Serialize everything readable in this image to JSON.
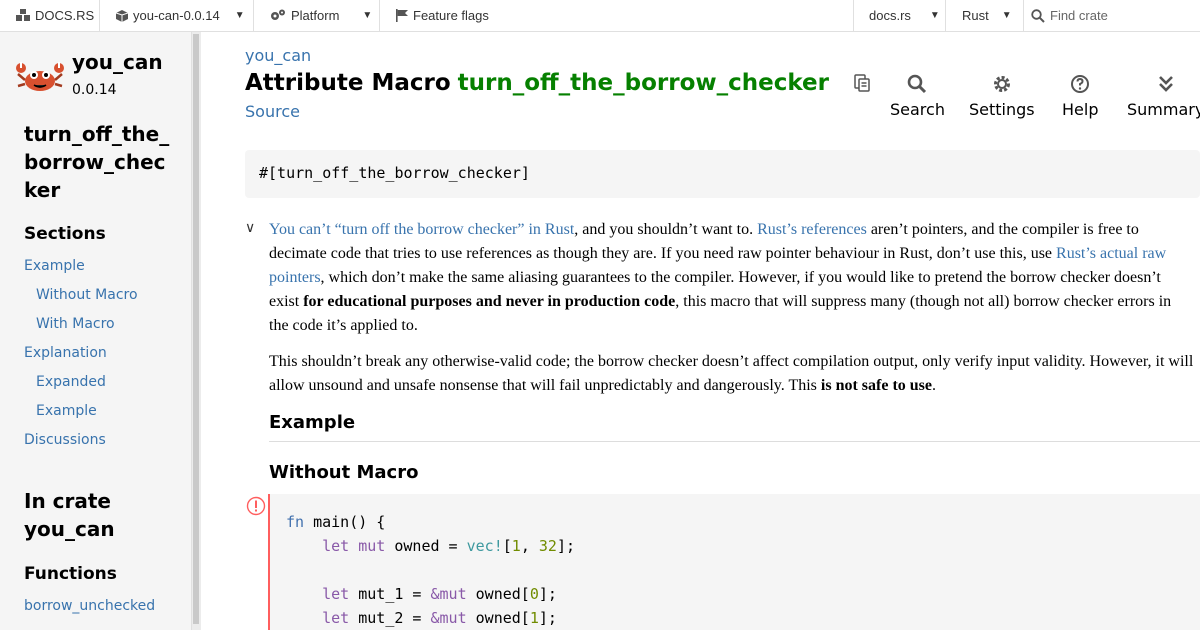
{
  "topbar": {
    "docsrs": "DOCS.RS",
    "crate_menu": "you-can-0.0.14",
    "platform": "Platform",
    "feature_flags": "Feature flags",
    "docsrs_menu": "docs.rs",
    "rust_menu": "Rust",
    "find_placeholder": "Find crate"
  },
  "sidebar": {
    "crate_name": "you_can",
    "version": "0.0.14",
    "item_title": "turn_off_the_borrow_checker",
    "sections_heading": "Sections",
    "sections": [
      {
        "label": "Example"
      },
      {
        "label": "Without Macro"
      },
      {
        "label": "With Macro"
      },
      {
        "label": "Explanation"
      },
      {
        "label": "Expanded"
      },
      {
        "label": "Example"
      },
      {
        "label": "Discussions"
      }
    ],
    "in_crate_label": "In crate",
    "in_crate_name": "you_can",
    "functions_heading": "Functions",
    "functions": [
      {
        "label": "borrow_unchecked"
      }
    ]
  },
  "main": {
    "breadcrumb": "you_can",
    "title_prefix": "Attribute Macro",
    "title_name": "turn_off_the_borrow_checker",
    "source_link": "Source",
    "toolbar": {
      "search": "Search",
      "settings": "Settings",
      "help": "Help",
      "summary": "Summary"
    },
    "declaration": "#[turn_off_the_borrow_checker]",
    "doc": {
      "p1_link1": "You can’t “turn off the borrow checker” in Rust",
      "p1_t1": ", and you shouldn’t want to. ",
      "p1_link2": "Rust’s references",
      "p1_t2": " aren’t pointers, and the compiler is free to decimate code that tries to use references as though they are. If you need raw pointer behaviour in Rust, don’t use this, use ",
      "p1_link3": "Rust’s actual raw pointers",
      "p1_t3": ", which don’t make the same aliasing guarantees to the compiler. However, if you would like to pretend the borrow checker doesn’t exist ",
      "p1_bold": "for educational purposes and never in production code",
      "p1_t4": ", this macro that will suppress many (though not all) borrow checker errors in the code it’s applied to.",
      "p2_t1": "This shouldn’t break any otherwise-valid code; the borrow checker doesn’t affect compilation output, only verify input validity. However, it will allow unsound and unsafe nonsense that will fail unpredictably and dangerously. This ",
      "p2_bold": "is not safe to use",
      "p2_t2": "."
    },
    "example_heading": "Example",
    "without_macro_heading": "Without Macro",
    "code": {
      "l1_kw": "fn",
      "l1_rest": " main() {",
      "l2_let": "let",
      "l2_mut": "mut",
      "l2_rest": " owned = ",
      "l2_macro": "vec!",
      "l2_open": "[",
      "l2_n1": "1",
      "l2_comma": ", ",
      "l2_n2": "32",
      "l2_close": "];",
      "l4_let": "let",
      "l4_var": " mut_1 = ",
      "l4_ref": "&mut",
      "l4_rest": " owned[",
      "l4_idx": "0",
      "l4_end": "];",
      "l5_let": "let",
      "l5_var": " mut_2 = ",
      "l5_ref": "&mut",
      "l5_rest": " owned[",
      "l5_idx": "1",
      "l5_end": "];"
    }
  },
  "colors": {
    "link": "#3873ad",
    "macro_name": "#068000",
    "error_border": "#ff5e5e",
    "sidebar_bg": "#f5f5f5"
  }
}
